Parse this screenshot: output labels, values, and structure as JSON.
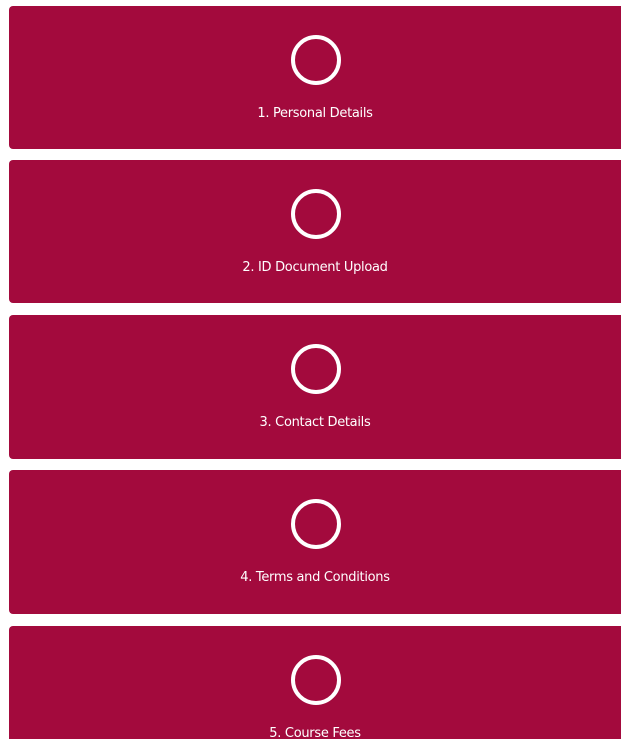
{
  "theme": {
    "card_color": "#a30a3d",
    "text_color": "#ffffff"
  },
  "steps": [
    {
      "label": "1. Personal Details",
      "icon": "empty-circle-icon"
    },
    {
      "label": "2. ID Document Upload",
      "icon": "empty-circle-icon"
    },
    {
      "label": "3. Contact Details",
      "icon": "empty-circle-icon"
    },
    {
      "label": "4. Terms and Conditions",
      "icon": "empty-circle-icon"
    },
    {
      "label": "5. Course Fees",
      "icon": "empty-circle-icon"
    }
  ]
}
